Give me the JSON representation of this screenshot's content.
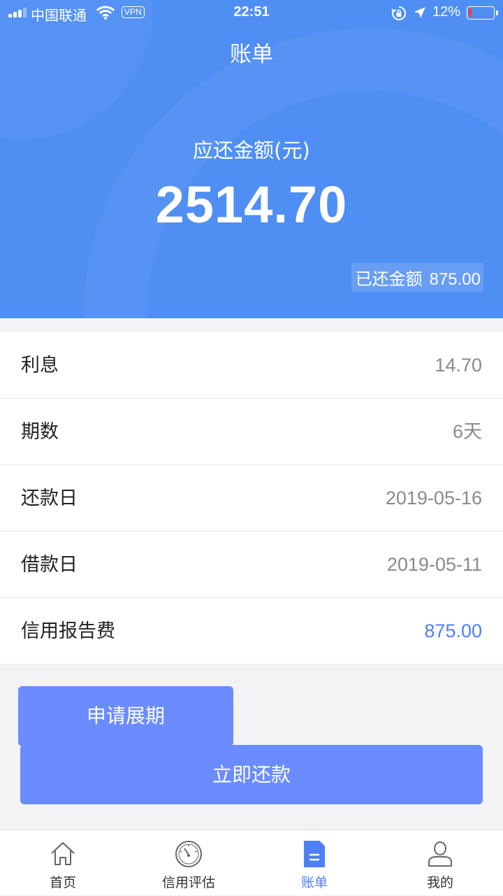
{
  "status_bar": {
    "carrier": "中国联通",
    "vpn": "VPN",
    "time": "22:51",
    "battery_percent": "12%",
    "battery_level": 0.12,
    "icons": [
      "signal-icon",
      "wifi-icon",
      "orientation-lock-icon",
      "location-icon",
      "battery-icon"
    ]
  },
  "header": {
    "title": "账单",
    "due_label": "应还金额(元)",
    "due_amount": "2514.70",
    "paid_label": "已还金额",
    "paid_amount": "875.00"
  },
  "details": [
    {
      "label": "利息",
      "value": "14.70"
    },
    {
      "label": "期数",
      "value": "6天"
    },
    {
      "label": "还款日",
      "value": "2019-05-16"
    },
    {
      "label": "借款日",
      "value": "2019-05-11"
    },
    {
      "label": "信用报告费",
      "value": "875.00",
      "accent": true
    }
  ],
  "actions": {
    "extend_label": "申请展期",
    "repay_label": "立即还款"
  },
  "tabbar": {
    "items": [
      {
        "label": "首页",
        "icon": "home-icon"
      },
      {
        "label": "信用评估",
        "icon": "gauge-icon"
      },
      {
        "label": "账单",
        "icon": "bill-icon",
        "active": true
      },
      {
        "label": "我的",
        "icon": "user-icon"
      }
    ]
  },
  "colors": {
    "header_bg": "#4f8ef3",
    "button_bg": "#6a8cff",
    "accent": "#4f7ff5",
    "battery_low": "#ff3b30"
  }
}
